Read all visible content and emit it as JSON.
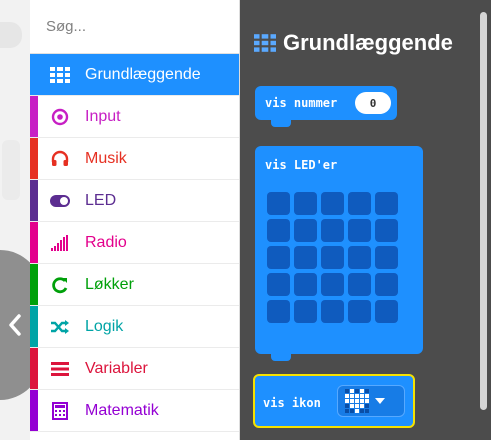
{
  "search": {
    "placeholder": "Søg..."
  },
  "categories": [
    {
      "label": "Grundlæggende",
      "icon": "grid-icon",
      "color": "#1e90ff",
      "selected": true
    },
    {
      "label": "Input",
      "icon": "target-icon",
      "color": "#c71fc4"
    },
    {
      "label": "Musik",
      "icon": "headphones-icon",
      "color": "#e63022"
    },
    {
      "label": "LED",
      "icon": "toggle-icon",
      "color": "#5c2d91"
    },
    {
      "label": "Radio",
      "icon": "signal-bars-icon",
      "color": "#e3008c"
    },
    {
      "label": "Løkker",
      "icon": "loop-arrow-icon",
      "color": "#00a00a"
    },
    {
      "label": "Logik",
      "icon": "shuffle-icon",
      "color": "#00a4a6"
    },
    {
      "label": "Variabler",
      "icon": "list-lines-icon",
      "color": "#dc143c"
    },
    {
      "label": "Matematik",
      "icon": "calculator-icon",
      "color": "#9400d3"
    }
  ],
  "flyout": {
    "title": "Grundlæggende",
    "blocks": {
      "show_number": {
        "label": "vis nummer",
        "value": "0"
      },
      "show_leds": {
        "label": "vis LED'er"
      },
      "show_icon": {
        "label": "vis ikon",
        "selected_icon": "heart-icon"
      }
    }
  }
}
